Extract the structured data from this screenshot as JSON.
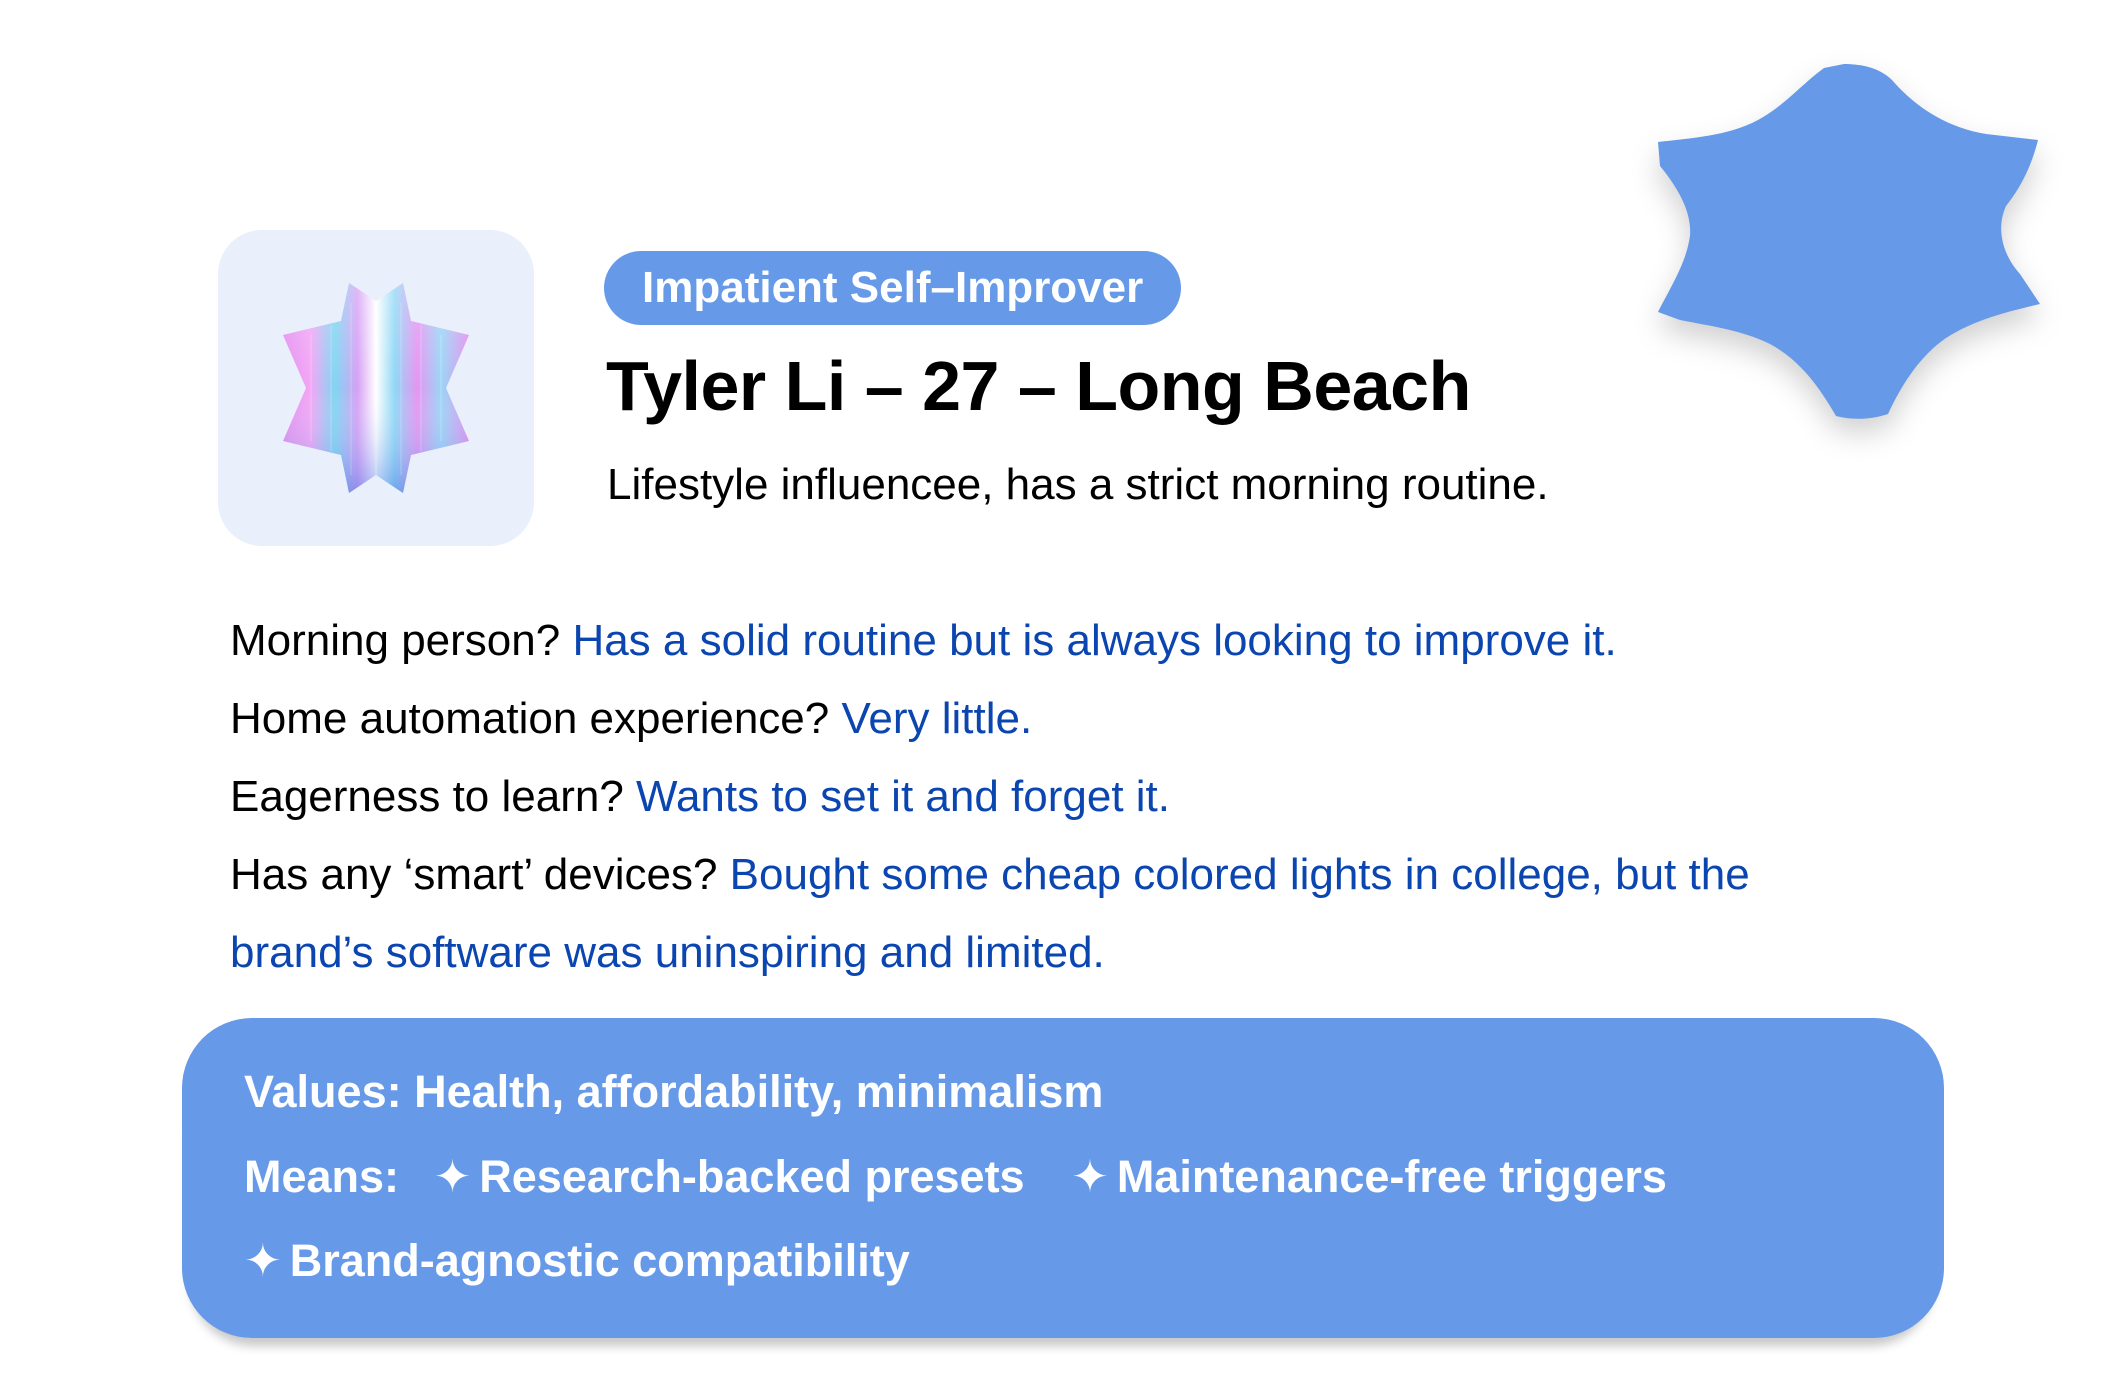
{
  "persona": {
    "archetype": "Impatient Self–Improver",
    "name_line": "Tyler Li – 27 – Long Beach",
    "tagline": "Lifestyle influencee, has a strict morning routine."
  },
  "qa": [
    {
      "q": "Morning person?",
      "a": "Has a solid routine but is always looking to improve it."
    },
    {
      "q": "Home automation experience?",
      "a": "Very little."
    },
    {
      "q": "Eagerness to learn?",
      "a": "Wants to set it and forget it."
    },
    {
      "q": "Has any ‘smart’ devices?",
      "a": "Bought some cheap colored lights in college, but the brand’s software was uninspiring and limited."
    }
  ],
  "values_card": {
    "values_line": "Values: Health, affordability, minimalism",
    "means_label": "Means:",
    "spark_glyph": "✦",
    "means": [
      "Research-backed presets",
      "Maintenance-free triggers",
      "Brand-agnostic compatibility"
    ]
  },
  "colors": {
    "accent_blue": "#6699e8",
    "answer_blue": "#0b45b0",
    "avatar_bg": "#e9f0fb"
  },
  "icons": {
    "avatar": "iridescent-star-shape-icon",
    "decoration": "blue-star-blob-icon"
  }
}
